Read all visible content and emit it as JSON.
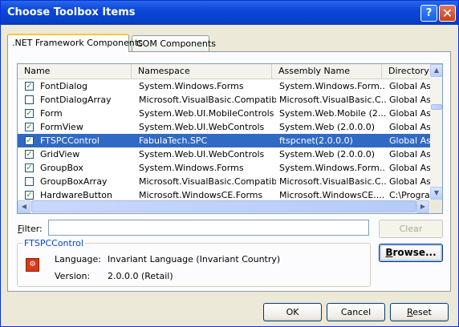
{
  "window": {
    "title": "Choose Toolbox Items",
    "help_glyph": "?",
    "close_glyph": "✕"
  },
  "tabs": [
    {
      "label": ".NET Framework Components",
      "active": true
    },
    {
      "label": "COM Components",
      "active": false
    }
  ],
  "grid": {
    "columns": [
      "Name",
      "Namespace",
      "Assembly Name",
      "Directory"
    ],
    "rows": [
      {
        "checked": true,
        "name": "FontDialog",
        "namespace": "System.Windows.Forms",
        "assembly": "System.Windows.Form...",
        "directory": "Global Ass"
      },
      {
        "checked": false,
        "name": "FontDialogArray",
        "namespace": "Microsoft.VisualBasic.Compatibi...",
        "assembly": "Microsoft.VisualBasic.C...",
        "directory": "Global Ass"
      },
      {
        "checked": true,
        "name": "Form",
        "namespace": "System.Web.UI.MobileControls",
        "assembly": "System.Web.Mobile (2....",
        "directory": "Global Ass"
      },
      {
        "checked": true,
        "name": "FormView",
        "namespace": "System.Web.UI.WebControls",
        "assembly": "System.Web (2.0.0.0)",
        "directory": "Global Ass"
      },
      {
        "checked": true,
        "name": "FTSPCControl",
        "namespace": "FabulaTech.SPC",
        "assembly": "ftspcnet(2.0.0.0)",
        "directory": "Global Ass",
        "selected": true
      },
      {
        "checked": true,
        "name": "GridView",
        "namespace": "System.Web.UI.WebControls",
        "assembly": "System.Web (2.0.0.0)",
        "directory": "Global Ass"
      },
      {
        "checked": true,
        "name": "GroupBox",
        "namespace": "System.Windows.Forms",
        "assembly": "System.Windows.Form...",
        "directory": "Global Ass"
      },
      {
        "checked": false,
        "name": "GroupBoxArray",
        "namespace": "Microsoft.VisualBasic.Compatibi...",
        "assembly": "Microsoft.VisualBasic.C...",
        "directory": "Global Ass"
      },
      {
        "checked": true,
        "name": "HardwareButton",
        "namespace": "Microsoft.WindowsCE.Forms",
        "assembly": "Microsoft.WindowsCE....",
        "directory": "C:\\Progra"
      }
    ]
  },
  "filter": {
    "label_pre": "",
    "label_hot": "F",
    "label_post": "ilter:",
    "value": "",
    "clear_label": "Clear"
  },
  "browse": {
    "label_hot": "B",
    "label_post": "rowse..."
  },
  "details": {
    "title": "FTSPCControl",
    "language_label": "Language:",
    "language_value": "Invariant Language (Invariant Country)",
    "version_label": "Version:",
    "version_value": "2.0.0.0 (Retail)"
  },
  "buttons": {
    "ok": "OK",
    "cancel": "Cancel",
    "reset_hot": "R",
    "reset_post": "eset"
  },
  "colors": {
    "selection": "#316ac5",
    "title_bar": "#0a46d8",
    "group_title": "#0046d5"
  }
}
